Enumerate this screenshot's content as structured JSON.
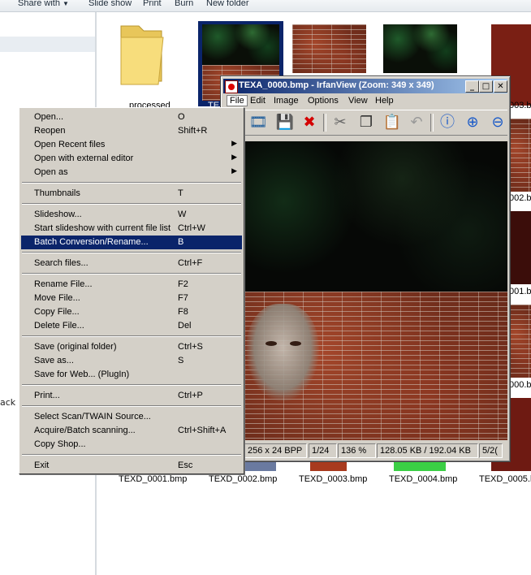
{
  "explorer": {
    "toolbar": [
      "Share with",
      "Slide show",
      "Print",
      "Burn",
      "New folder"
    ],
    "nav_peek": "ack",
    "files_top": [
      {
        "name": "processed",
        "kind": "folder"
      },
      {
        "name": "TE",
        "kind": "forest"
      },
      {
        "name": "",
        "kind": "brick"
      },
      {
        "name": "",
        "kind": "forest"
      },
      {
        "name": "003.b",
        "kind": "brick"
      }
    ],
    "files_right": [
      "002.b",
      "001.b",
      "000.b"
    ],
    "files_bottom": [
      "TEXD_0001.bmp",
      "TEXD_0002.bmp",
      "TEXD_0003.bmp",
      "TEXD_0004.bmp",
      "TEXD_0005.b"
    ]
  },
  "irfanview": {
    "title": "TEXA_0000.bmp - IrfanView (Zoom: 349 x 349)",
    "menu": [
      "File",
      "Edit",
      "Image",
      "Options",
      "View",
      "Help"
    ],
    "toolbar_icons": [
      "slideshow-icon",
      "save-icon",
      "delete-icon",
      "cut-icon",
      "copy-icon",
      "paste-icon",
      "undo-icon",
      "info-icon",
      "zoom-in-icon",
      "zoom-out-icon"
    ],
    "status": {
      "dims": "256 x 24 BPP",
      "index": "1/24",
      "zoom": "136 %",
      "size": "128.05 KB / 192.04 KB",
      "extra": "5/2("
    }
  },
  "file_menu": {
    "items": [
      {
        "label": "Open...",
        "accel": "O"
      },
      {
        "label": "Reopen",
        "accel": "Shift+R"
      },
      {
        "label": "Open Recent files",
        "accel": "",
        "submenu": true
      },
      {
        "label": "Open with external editor",
        "accel": "",
        "submenu": true
      },
      {
        "label": "Open as",
        "accel": "",
        "submenu": true
      },
      {
        "label": "Thumbnails",
        "accel": "T"
      },
      {
        "label": "Slideshow...",
        "accel": "W"
      },
      {
        "label": "Start slideshow with current file list",
        "accel": "Ctrl+W"
      },
      {
        "label": "Batch Conversion/Rename...",
        "accel": "B",
        "selected": true
      },
      {
        "label": "Search files...",
        "accel": "Ctrl+F"
      },
      {
        "label": "Rename File...",
        "accel": "F2"
      },
      {
        "label": "Move File...",
        "accel": "F7"
      },
      {
        "label": "Copy File...",
        "accel": "F8"
      },
      {
        "label": "Delete File...",
        "accel": "Del"
      },
      {
        "label": "Save (original folder)",
        "accel": "Ctrl+S"
      },
      {
        "label": "Save as...",
        "accel": "S"
      },
      {
        "label": "Save for Web... (PlugIn)",
        "accel": ""
      },
      {
        "label": "Print...",
        "accel": "Ctrl+P"
      },
      {
        "label": "Select Scan/TWAIN Source...",
        "accel": ""
      },
      {
        "label": "Acquire/Batch scanning...",
        "accel": "Ctrl+Shift+A"
      },
      {
        "label": "Copy Shop...",
        "accel": ""
      },
      {
        "label": "Exit",
        "accel": "Esc"
      }
    ]
  }
}
